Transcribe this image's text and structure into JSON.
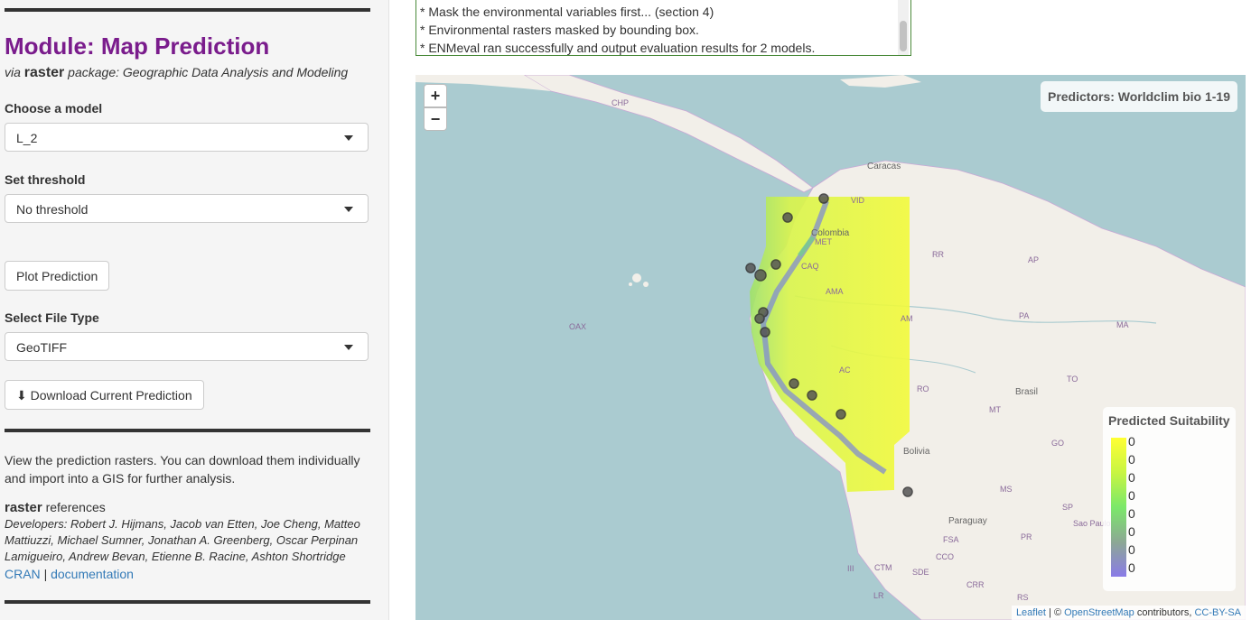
{
  "sidebar": {
    "title": "Module: Map Prediction",
    "subtitle_prefix": "via",
    "subtitle_pkg": "raster",
    "subtitle_rest": "package: Geographic Data Analysis and Modeling",
    "model_label": "Choose a model",
    "model_value": "L_2",
    "threshold_label": "Set threshold",
    "threshold_value": "No threshold",
    "plot_button": "Plot Prediction",
    "filetype_label": "Select File Type",
    "filetype_value": "GeoTIFF",
    "download_button": "Download Current Prediction",
    "description": "View the prediction rasters. You can download them individually and import into a GIS for further analysis.",
    "ref_pkg": "raster",
    "ref_word": "references",
    "developers": "Developers: Robert J. Hijmans, Jacob van Etten, Joe Cheng, Matteo Mattiuzzi, Michael Sumner, Jonathan A. Greenberg, Oscar Perpinan Lamigueiro, Andrew Bevan, Etienne B. Racine, Ashton Shortridge",
    "cran_link": "CRAN",
    "sep": "|",
    "doc_link": "documentation"
  },
  "log": {
    "lines": [
      "* Mask the environmental variables first... (section 4)",
      "* Environmental rasters masked by bounding box.",
      "* ENMeval ran successfully and output evaluation results for 2 models."
    ]
  },
  "map": {
    "zoom_in": "+",
    "zoom_out": "−",
    "predictors": "Predictors: Worldclim bio 1-19",
    "legend_title": "Predicted Suitability",
    "legend_ticks": [
      "0",
      "0",
      "0",
      "0",
      "0",
      "0",
      "0",
      "0"
    ],
    "attribution_leaflet": "Leaflet",
    "attribution_sep": "| ©",
    "attribution_osm": "OpenStreetMap",
    "attribution_contrib": "contributors,",
    "attribution_license": "CC-BY-SA",
    "labels": [
      "OAX",
      "CHP",
      "Caracas",
      "VID",
      "Colombia",
      "MET",
      "CAQ",
      "AMA",
      "AP",
      "RR",
      "PA",
      "MA",
      "AM",
      "AC",
      "RO",
      "Brasil",
      "TO",
      "MT",
      "GO",
      "MS",
      "Bolivia",
      "SP",
      "Paraguay",
      "Sao Paulo",
      "PR",
      "FSA",
      "CCO",
      "CRR",
      "RS",
      "CTM",
      "SDE",
      "LR",
      "III"
    ]
  }
}
